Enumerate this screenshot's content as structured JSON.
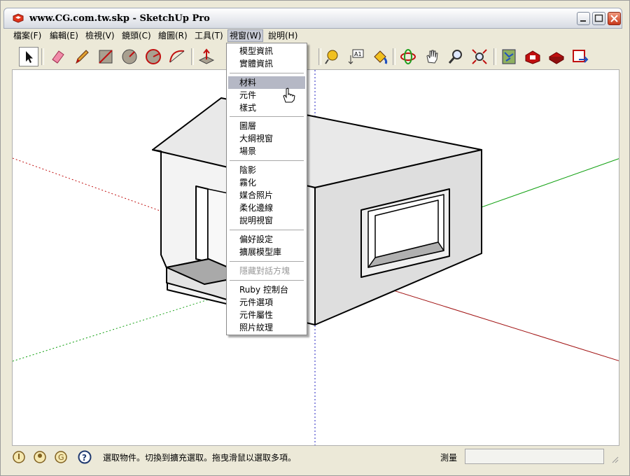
{
  "window": {
    "title": "www.CG.com.tw.skp - SketchUp Pro"
  },
  "menubar": {
    "items": [
      {
        "label": "檔案(F)"
      },
      {
        "label": "編輯(E)"
      },
      {
        "label": "檢視(V)"
      },
      {
        "label": "鏡頭(C)"
      },
      {
        "label": "繪圖(R)"
      },
      {
        "label": "工具(T)"
      },
      {
        "label": "視窗(W)"
      },
      {
        "label": "說明(H)"
      }
    ],
    "active_index": 6
  },
  "dropdown": {
    "groups": [
      [
        "模型資訊",
        "實體資訊"
      ],
      [
        "材料",
        "元件",
        "樣式"
      ],
      [
        "圖層",
        "大綱視窗",
        "場景"
      ],
      [
        "陰影",
        "霧化",
        "媒合照片",
        "柔化邊線",
        "說明視窗"
      ],
      [
        "偏好設定",
        "擴展模型庫"
      ],
      [
        "隱藏對話方塊"
      ],
      [
        "Ruby 控制台",
        "元件選項",
        "元件屬性",
        "照片紋理"
      ]
    ],
    "highlighted": "材料",
    "disabled": [
      "隱藏對話方塊"
    ]
  },
  "toolbar": {
    "tools": [
      "select-icon",
      "eraser-icon",
      "pencil-icon",
      "rectangle-icon",
      "circle-icon",
      "polygon-icon",
      "arc-icon",
      "push-pull-icon",
      "follow-me-icon",
      "move-icon",
      "tape-measure-icon",
      "text-icon",
      "paint-bucket-icon",
      "orbit-icon",
      "pan-icon",
      "zoom-icon",
      "zoom-extents-icon",
      "map-icon",
      "warehouse-icon",
      "share-icon",
      "layout-icon"
    ]
  },
  "statusbar": {
    "message": "選取物件。切換到擴充選取。拖曳滑鼠以選取多項。",
    "measure_label": "測量",
    "measure_value": ""
  },
  "colors": {
    "axis_red": "#c01010",
    "axis_green": "#10a010",
    "axis_blue": "#2020c0",
    "menu_highlight": "#b5b8c5"
  }
}
